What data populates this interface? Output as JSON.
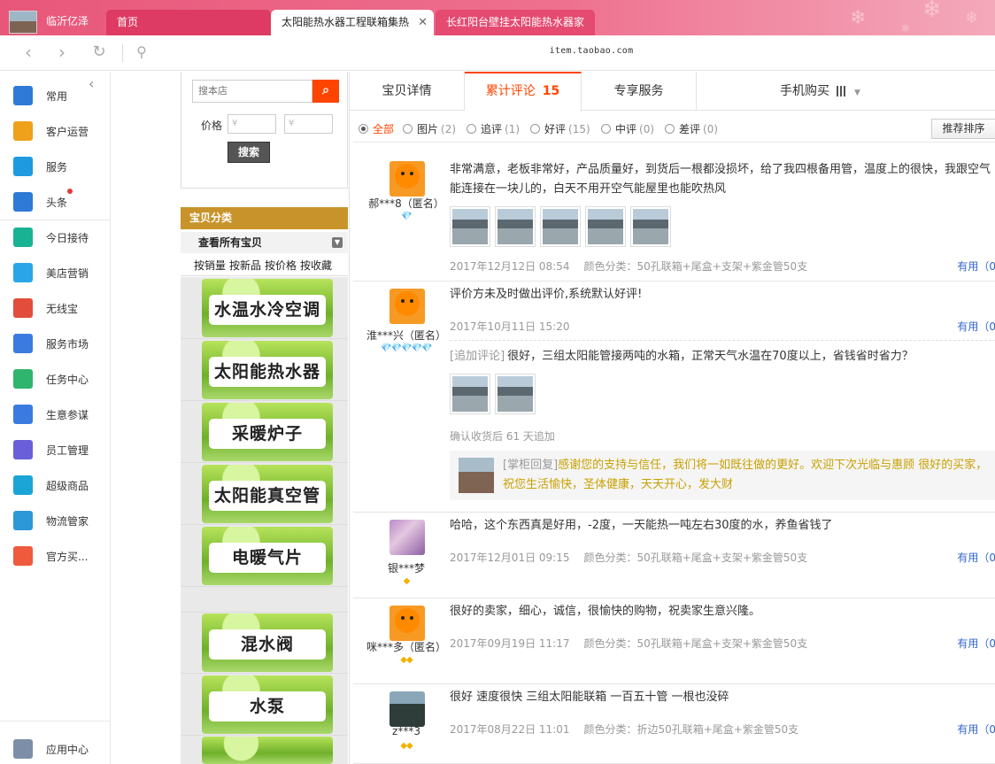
{
  "browser": {
    "tabs": [
      {
        "label": "临沂亿泽"
      },
      {
        "label": "首页"
      },
      {
        "label": "太阳能热水器工程联箱集热"
      },
      {
        "label": "长红阳台壁挂太阳能热水器家"
      }
    ],
    "url": "item.taobao.com"
  },
  "sidebar": {
    "items": [
      {
        "label": "常用",
        "icon": "list-icon",
        "color": "#2e7ad6"
      },
      {
        "label": "客户运营",
        "icon": "pinwheel-icon",
        "color": "#f0a11b"
      },
      {
        "label": "服务",
        "icon": "shopping-bag-icon",
        "color": "#1e9ae0"
      },
      {
        "label": "头条",
        "icon": "news-icon",
        "color": "#2e7ad6"
      },
      {
        "label": "今日接待",
        "icon": "reception-icon",
        "color": "#19b394"
      },
      {
        "label": "美店营销",
        "icon": "marketing-icon",
        "color": "#2aa6e8"
      },
      {
        "label": "无线宝",
        "icon": "wireless-icon",
        "color": "#e24d3c"
      },
      {
        "label": "服务市场",
        "icon": "market-icon",
        "color": "#3b7be0"
      },
      {
        "label": "任务中心",
        "icon": "task-icon",
        "color": "#2fb56d"
      },
      {
        "label": "生意参谋",
        "icon": "compass-icon",
        "color": "#3b7be0"
      },
      {
        "label": "员工管理",
        "icon": "staff-icon",
        "color": "#6a5fd8"
      },
      {
        "label": "超级商品",
        "icon": "refresh-icon",
        "color": "#1aa5d6"
      },
      {
        "label": "物流管家",
        "icon": "logistics-icon",
        "color": "#2c98d8"
      },
      {
        "label": "官方买...",
        "icon": "official-icon",
        "color": "#ef5a3c"
      },
      {
        "label": "应用中心",
        "icon": "apps-icon",
        "color": "#7d8fa8"
      }
    ]
  },
  "shop": {
    "search_placeholder": "搜本店",
    "price_label": "价格",
    "price_min_placeholder": "¥",
    "price_max_placeholder": "¥",
    "search_button": "搜索",
    "category_header": "宝贝分类",
    "all_items": "查看所有宝贝",
    "sorts": [
      "按销量",
      "按新品",
      "按价格",
      "按收藏"
    ],
    "categories": [
      "水温水冷空调",
      "太阳能热水器",
      "采暖炉子",
      "太阳能真空管",
      "电暖气片",
      "混水阀",
      "水泵"
    ]
  },
  "detail_tabs": [
    {
      "label": "宝贝详情"
    },
    {
      "label": "累计评论",
      "count": "15"
    },
    {
      "label": "专享服务"
    },
    {
      "label": "手机购买"
    }
  ],
  "filters": [
    {
      "label": "全部",
      "count": ""
    },
    {
      "label": "图片",
      "count": "(2)"
    },
    {
      "label": "追评",
      "count": "(1)"
    },
    {
      "label": "好评",
      "count": "(15)"
    },
    {
      "label": "中评",
      "count": "(0)"
    },
    {
      "label": "差评",
      "count": "(0)"
    }
  ],
  "sort_button": "推荐排序",
  "reviews": [
    {
      "user": "郝***8（匿名）",
      "badge": "💎",
      "text": "非常满意，老板非常好，产品质量好，到货后一根都没损坏，给了我四根备用管，温度上的很快，我跟空气能连接在一块儿的，白天不用开空气能屋里也能吹热风",
      "date": "2017年12月12日 08:54",
      "sku": "颜色分类：50孔联箱+尾盒+支架+紫金管50支",
      "useful": "有用（0"
    },
    {
      "user": "淮***兴（匿名）",
      "badge": "💎💎💎💎💎",
      "text": "评价方未及时做出评价,系统默认好评!",
      "date": "2017年10月11日 15:20",
      "useful": "有用（0",
      "append_label": "[追加评论]",
      "append_text": "很好，三组太阳能管接两吨的水箱，正常天气水温在70度以上，省钱省时省力？",
      "append_time": "确认收货后 61 天追加",
      "reply_label": "[掌柜回复]",
      "reply_text": "感谢您的支持与信任，我们将一如既往做的更好。欢迎下次光临与惠顾 很好的买家，祝您生活愉快，圣体健康，天天开心，发大财"
    },
    {
      "user": "银***梦",
      "badge": "◆",
      "text": "哈哈，这个东西真是好用，-2度，一天能热一吨左右30度的水，养鱼省钱了",
      "date": "2017年12月01日 09:15",
      "sku": "颜色分类：50孔联箱+尾盒+支架+紫金管50支",
      "useful": "有用（0"
    },
    {
      "user": "咪***多（匿名）",
      "badge": "◆◆",
      "text": "很好的卖家，细心，诚信，很愉快的购物，祝卖家生意兴隆。",
      "date": "2017年09月19日 11:17",
      "sku": "颜色分类：50孔联箱+尾盒+支架+紫金管50支",
      "useful": "有用（0"
    },
    {
      "user": "z***3",
      "badge": "◆◆",
      "text": "很好 速度很快 三组太阳能联箱 一百五十管 一根也没碎",
      "date": "2017年08月22日 11:01",
      "sku": "颜色分类：折边50孔联箱+尾盒+紫金管50支",
      "useful": "有用（0"
    }
  ]
}
